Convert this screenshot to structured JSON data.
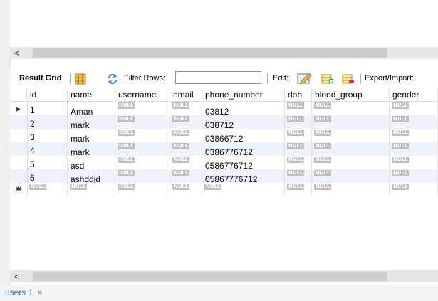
{
  "toolbar": {
    "result_grid_label": "Result Grid",
    "filter_rows_label": "Filter Rows:",
    "filter_value": "",
    "edit_label": "Edit:",
    "export_label": "Export/Import:"
  },
  "columns": [
    "id",
    "name",
    "username",
    "email",
    "phone_number",
    "dob",
    "blood_group",
    "gender"
  ],
  "rows": [
    [
      "1",
      "Aman",
      "NULL",
      "NULL",
      "03812",
      "NULL",
      "NULL",
      "NULL"
    ],
    [
      "2",
      "mark",
      "NULL",
      "NULL",
      "038712",
      "NULL",
      "NULL",
      "NULL"
    ],
    [
      "3",
      "mark",
      "NULL",
      "NULL",
      "03866712",
      "NULL",
      "NULL",
      "NULL"
    ],
    [
      "4",
      "mark",
      "NULL",
      "NULL",
      "0386776712",
      "NULL",
      "NULL",
      "NULL"
    ],
    [
      "5",
      "asd",
      "NULL",
      "NULL",
      "0586776712",
      "NULL",
      "NULL",
      "NULL"
    ],
    [
      "6",
      "ashddjd",
      "NULL",
      "NULL",
      "05867776712",
      "NULL",
      "NULL",
      "NULL"
    ],
    [
      "NULL",
      "NULL",
      "NULL",
      "NULL",
      "NULL",
      "NULL",
      "NULL",
      "NULL"
    ]
  ],
  "row_indicators": {
    "current": "▶",
    "new": "✱"
  },
  "tabs": [
    {
      "label": "users 1",
      "close": "×"
    }
  ],
  "icons": {
    "scroll_left": "<",
    "grid_icon": "grid-icon",
    "refresh_icon": "refresh-icon",
    "edit_pencil_icon": "edit-pencil-icon",
    "add_row_icon": "add-row-icon",
    "delete_row_icon": "delete-row-icon"
  }
}
